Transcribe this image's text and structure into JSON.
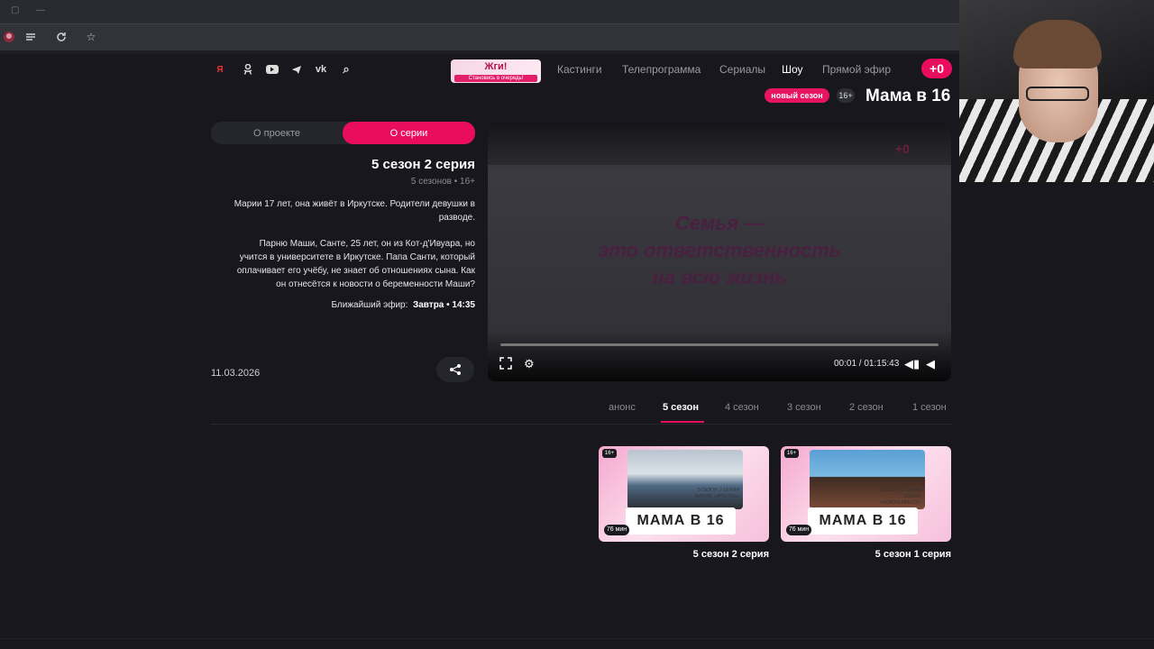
{
  "browser": {
    "window_controls": [
      "—",
      "▢"
    ],
    "toolbar_icons": [
      "avatar-icon",
      "list-icon",
      "reload-icon",
      "star-icon"
    ]
  },
  "site": {
    "logo": "+0",
    "nav": [
      "Прямой эфир",
      "Шоу",
      "Сериалы",
      "Телепрограмма",
      "Кастинги"
    ],
    "nav_active": "Шоу",
    "banner": {
      "title": "Жги!",
      "subtitle": "Становись в очередь!"
    },
    "social": [
      "vk",
      "telegram",
      "youtube",
      "ok",
      "yandex"
    ],
    "colors": {
      "accent": "#ea0d5f",
      "bg": "#17171d"
    }
  },
  "show": {
    "title": "Мама в 16",
    "age": "16+",
    "badge": "новый сезон"
  },
  "info": {
    "tabs": [
      "О серии",
      "О проекте"
    ],
    "active_tab": "О серии",
    "episode_title": "5 сезон 2 серия",
    "episode_meta": "5 сезонов • 16+",
    "desc1_l1": "Марии 17 лет, она живёт в Иркутске. Родители девушки в",
    "desc1_l2": "разводе.",
    "desc2_l1": "Парню Маши, Санте, 25 лет, он из Кот-д'Ивуара, но",
    "desc2_l2": "учится в университете в Иркутске. Папа Санти, который",
    "desc2_l3": "оплачивает его учёбу, не знает об отношениях сына. Как",
    "desc2_l4": "он отнесётся к новости о беременности Маши?",
    "air_label": "Ближайший эфир:",
    "air_value": "Завтра • 14:35",
    "date": "11.03.2026"
  },
  "player": {
    "watermark": "+0",
    "video_text_l1": "Семья —",
    "video_text_l2": "это ответственность",
    "video_text_l3": "на всю жизнь",
    "time": "00:01 / 01:15:43",
    "progress": 0.0
  },
  "seasons": {
    "items": [
      "1 сезон",
      "2 сезон",
      "3 сезон",
      "4 сезон",
      "5 сезон",
      "анонс"
    ],
    "active": "5 сезон"
  },
  "cards": [
    {
      "title": "5 сезон 1 серия",
      "age": "16+",
      "duration": "76 мин",
      "thumb_title": "МАМА В 16",
      "caption": "5 СЕЗОН, 1 СЕРИЯ СОФЬЯ, «НОВОЧЕРКАССК»"
    },
    {
      "title": "5 сезон 2 серия",
      "age": "16+",
      "duration": "76 мин",
      "thumb_title": "МАМА В 16",
      "caption": "5 СЕЗОН, 2 СЕРИЯ МАРИЯ, «ИРКУТСК»"
    }
  ]
}
